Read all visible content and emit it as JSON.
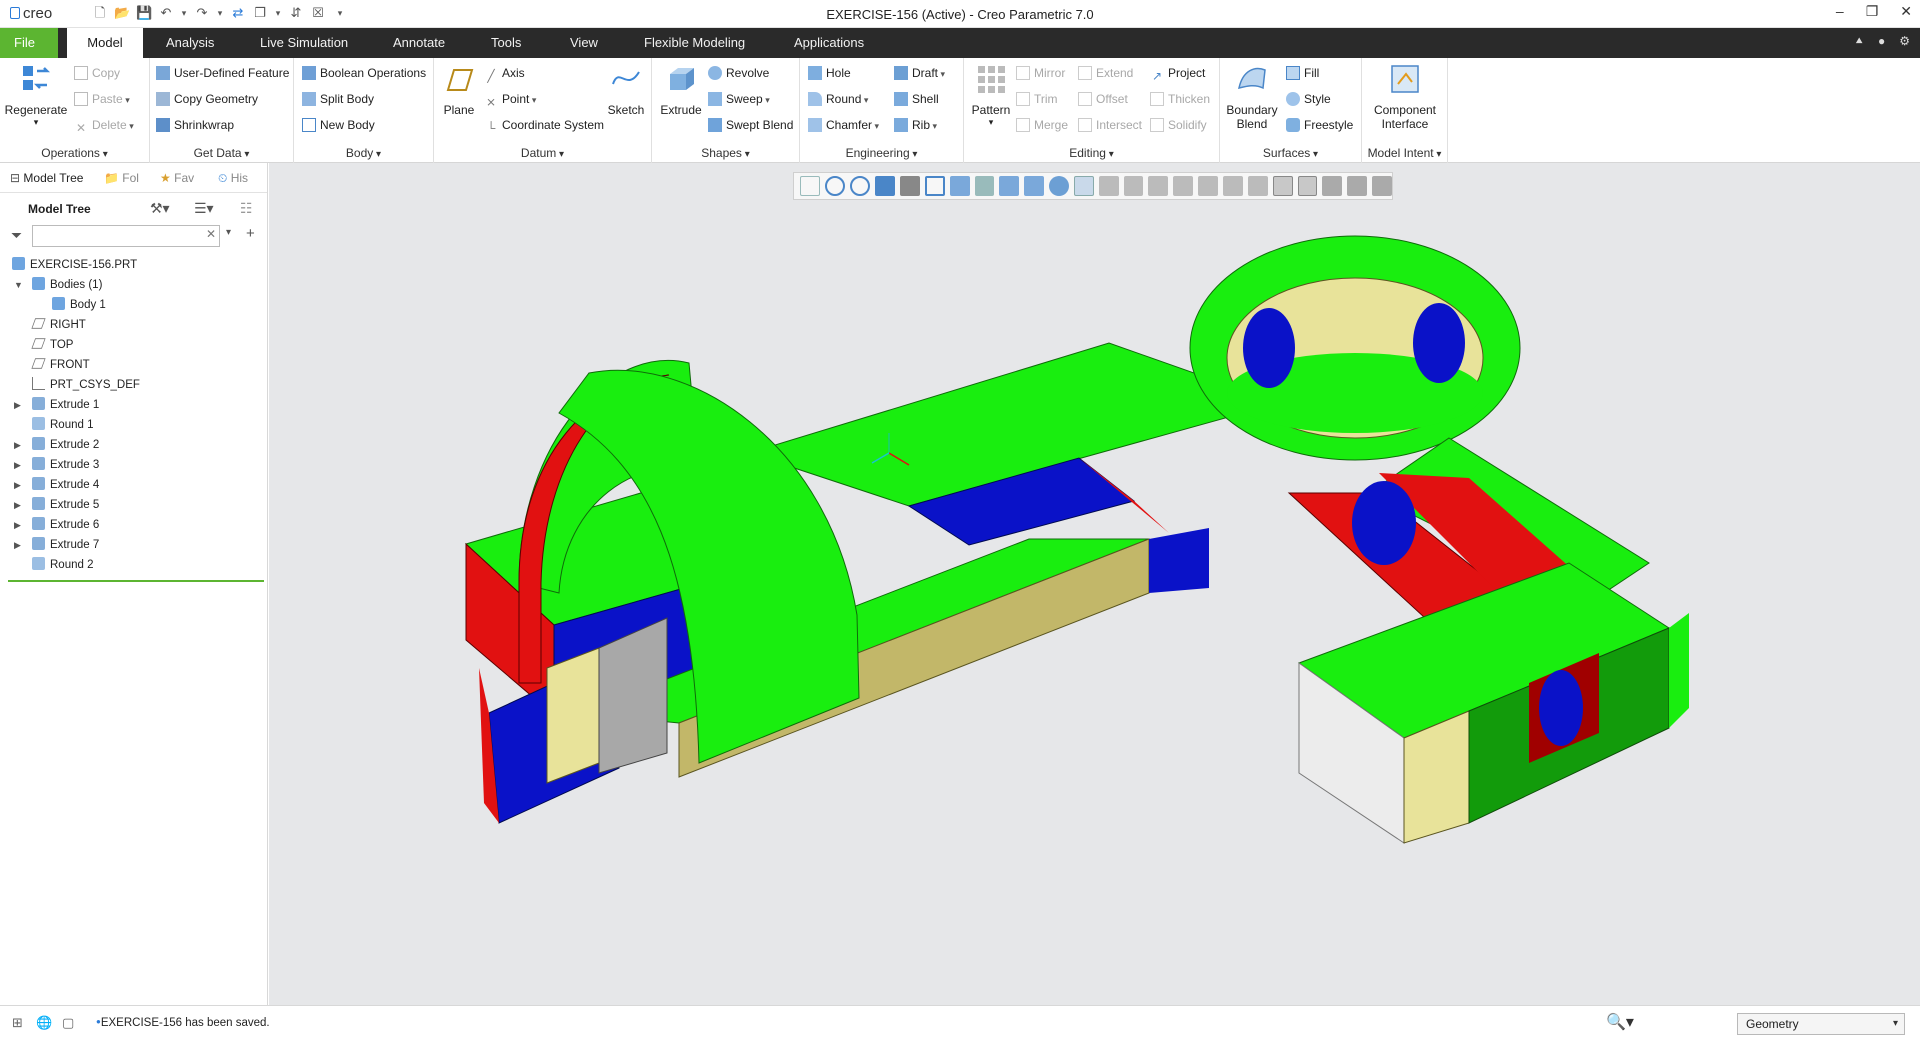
{
  "window": {
    "app_logo": "creo",
    "title": "EXERCISE-156 (Active) - Creo Parametric 7.0"
  },
  "tabs": [
    "File",
    "Model",
    "Analysis",
    "Live Simulation",
    "Annotate",
    "Tools",
    "View",
    "Flexible Modeling",
    "Applications"
  ],
  "ribbon": {
    "operations": {
      "label": "Operations",
      "regenerate": "Regenerate",
      "copy": "Copy",
      "paste": "Paste",
      "delete": "Delete"
    },
    "get_data": {
      "label": "Get Data",
      "udf": "User-Defined Feature",
      "copy_geometry": "Copy Geometry",
      "shrinkwrap": "Shrinkwrap"
    },
    "body": {
      "label": "Body",
      "boolean": "Boolean Operations",
      "split": "Split Body",
      "new": "New Body"
    },
    "datum": {
      "label": "Datum",
      "plane": "Plane",
      "axis": "Axis",
      "point": "Point",
      "csys": "Coordinate System",
      "sketch": "Sketch"
    },
    "shapes": {
      "label": "Shapes",
      "extrude": "Extrude",
      "revolve": "Revolve",
      "sweep": "Sweep",
      "swept_blend": "Swept Blend"
    },
    "engineering": {
      "label": "Engineering",
      "hole": "Hole",
      "round": "Round",
      "chamfer": "Chamfer",
      "draft": "Draft",
      "shell": "Shell",
      "rib": "Rib"
    },
    "editing": {
      "label": "Editing",
      "pattern": "Pattern",
      "mirror": "Mirror",
      "trim": "Trim",
      "merge": "Merge",
      "extend": "Extend",
      "offset": "Offset",
      "intersect": "Intersect",
      "project": "Project",
      "thicken": "Thicken",
      "solidify": "Solidify"
    },
    "surfaces": {
      "label": "Surfaces",
      "boundary_blend_1": "Boundary",
      "boundary_blend_2": "Blend",
      "fill": "Fill",
      "style": "Style",
      "freestyle": "Freestyle"
    },
    "model_intent": {
      "label": "Model Intent",
      "component_1": "Component",
      "component_2": "Interface"
    }
  },
  "navigator": {
    "tabs": [
      "Model Tree",
      "Fol",
      "Fav",
      "His"
    ],
    "header": "Model Tree",
    "search_value": "",
    "tree": [
      {
        "label": "EXERCISE-156.PRT",
        "icon": "part-icon",
        "indent": 0,
        "expander": ""
      },
      {
        "label": "Bodies (1)",
        "icon": "bodies-icon",
        "indent": 1,
        "expander": "▼"
      },
      {
        "label": "Body 1",
        "icon": "body-icon",
        "indent": 2,
        "expander": ""
      },
      {
        "label": "RIGHT",
        "icon": "datum-plane-icon",
        "indent": 1,
        "expander": ""
      },
      {
        "label": "TOP",
        "icon": "datum-plane-icon",
        "indent": 1,
        "expander": ""
      },
      {
        "label": "FRONT",
        "icon": "datum-plane-icon",
        "indent": 1,
        "expander": ""
      },
      {
        "label": "PRT_CSYS_DEF",
        "icon": "csys-icon",
        "indent": 1,
        "expander": ""
      },
      {
        "label": "Extrude 1",
        "icon": "extrude-icon",
        "indent": 1,
        "expander": "▶"
      },
      {
        "label": "Round 1",
        "icon": "round-icon",
        "indent": 1,
        "expander": ""
      },
      {
        "label": "Extrude 2",
        "icon": "extrude-icon",
        "indent": 1,
        "expander": "▶"
      },
      {
        "label": "Extrude 3",
        "icon": "extrude-icon",
        "indent": 1,
        "expander": "▶"
      },
      {
        "label": "Extrude 4",
        "icon": "extrude-icon",
        "indent": 1,
        "expander": "▶"
      },
      {
        "label": "Extrude 5",
        "icon": "extrude-icon",
        "indent": 1,
        "expander": "▶"
      },
      {
        "label": "Extrude 6",
        "icon": "extrude-icon",
        "indent": 1,
        "expander": "▶"
      },
      {
        "label": "Extrude 7",
        "icon": "extrude-icon",
        "indent": 1,
        "expander": "▶"
      },
      {
        "label": "Round 2",
        "icon": "round-icon",
        "indent": 1,
        "expander": ""
      }
    ]
  },
  "status": {
    "message": "EXERCISE-156 has been saved.",
    "selection_filter": "Geometry"
  },
  "colors": {
    "accent_green": "#5cb531",
    "tab_bar": "#2a2a2a",
    "viewport_bg": "#e6e7e9",
    "model_green": "#19ee0f",
    "model_red": "#e11111",
    "model_blue": "#0a12c8",
    "model_tan": "#e8e39a",
    "model_gray": "#a8a8a8"
  }
}
